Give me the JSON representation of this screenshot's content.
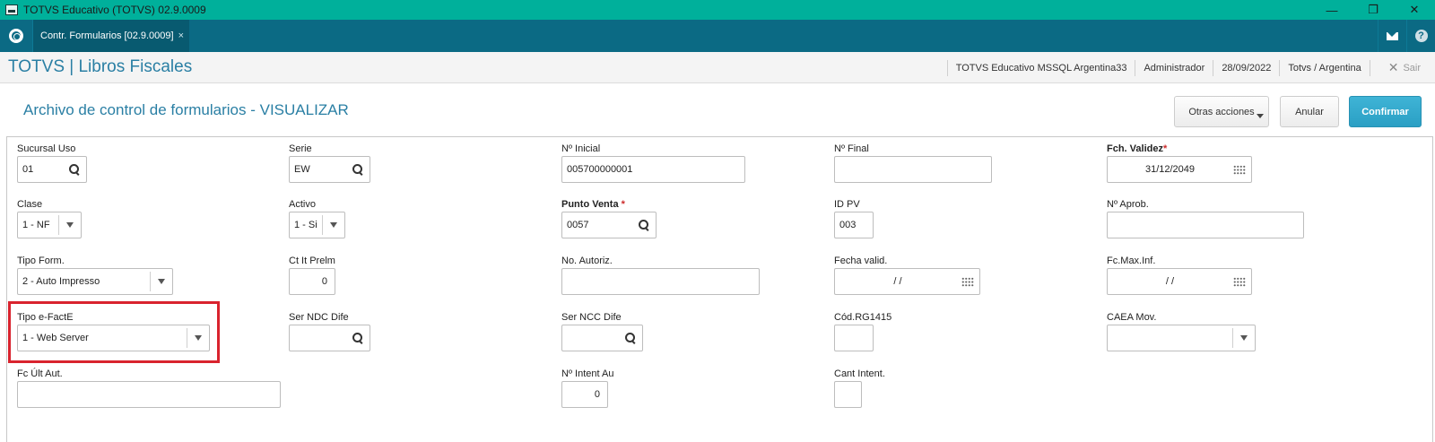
{
  "window": {
    "title": "TOTVS Educativo (TOTVS) 02.9.0009",
    "minimize": "—",
    "maximize": "❐",
    "close": "✕"
  },
  "tabbar": {
    "tab_label": "Contr. Formularios [02.9.0009]",
    "tab_close": "×"
  },
  "header": {
    "app_title": "TOTVS | Libros Fiscales",
    "environment": "TOTVS Educativo MSSQL Argentina33",
    "user": "Administrador",
    "date": "28/09/2022",
    "company": "Totvs / Argentina",
    "exit_label": "Sair"
  },
  "page": {
    "title": "Archivo de control de formularios - VISUALIZAR",
    "buttons": {
      "more": "Otras acciones",
      "cancel": "Anular",
      "confirm": "Confirmar"
    }
  },
  "form": {
    "sucursal_uso": {
      "label": "Sucursal Uso",
      "value": "01"
    },
    "serie": {
      "label": "Serie",
      "value": "EW"
    },
    "nro_inicial": {
      "label": "Nº Inicial",
      "value": "005700000001"
    },
    "nro_final": {
      "label": "Nº Final",
      "value": ""
    },
    "fch_validez": {
      "label": "Fch. Validez",
      "required_mark": "*",
      "value": "31/12/2049"
    },
    "clase": {
      "label": "Clase",
      "value": "1 - NF"
    },
    "activo": {
      "label": "Activo",
      "value": "1 - Si"
    },
    "punto_venta": {
      "label": "Punto Venta",
      "required_mark": "*",
      "value": "0057"
    },
    "id_pv": {
      "label": "ID PV",
      "value": "003"
    },
    "nro_aprob": {
      "label": "Nº Aprob.",
      "value": ""
    },
    "tipo_form": {
      "label": "Tipo Form.",
      "value": "2 - Auto Impresso"
    },
    "ct_it_prelm": {
      "label": "Ct It Prelm",
      "value": "0"
    },
    "no_autoriz": {
      "label": "No. Autoriz.",
      "value": ""
    },
    "fecha_valid": {
      "label": "Fecha valid.",
      "value": "/ /"
    },
    "fc_max_inf": {
      "label": "Fc.Max.Inf.",
      "value": "/ /"
    },
    "tipo_efacte": {
      "label": "Tipo e-FactE",
      "value": "1 - Web Server"
    },
    "ser_ndc_dife": {
      "label": "Ser NDC Dife",
      "value": ""
    },
    "ser_ncc_dife": {
      "label": "Ser NCC Dife",
      "value": ""
    },
    "cod_rg1415": {
      "label": "Cód.RG1415",
      "value": ""
    },
    "caea_mov": {
      "label": "CAEA Mov.",
      "value": ""
    },
    "fc_ult_aut": {
      "label": "Fc Últ Aut.",
      "value": ""
    },
    "nro_intent_au": {
      "label": "Nº Intent Au",
      "value": "0"
    },
    "cant_intent": {
      "label": "Cant Intent.",
      "value": ""
    }
  },
  "colors": {
    "titlebar": "#00b09b",
    "tabbar": "#0b6a84",
    "accent": "#2a7fa4",
    "confirm": "#2a9fc4",
    "highlight": "#d9232e"
  }
}
